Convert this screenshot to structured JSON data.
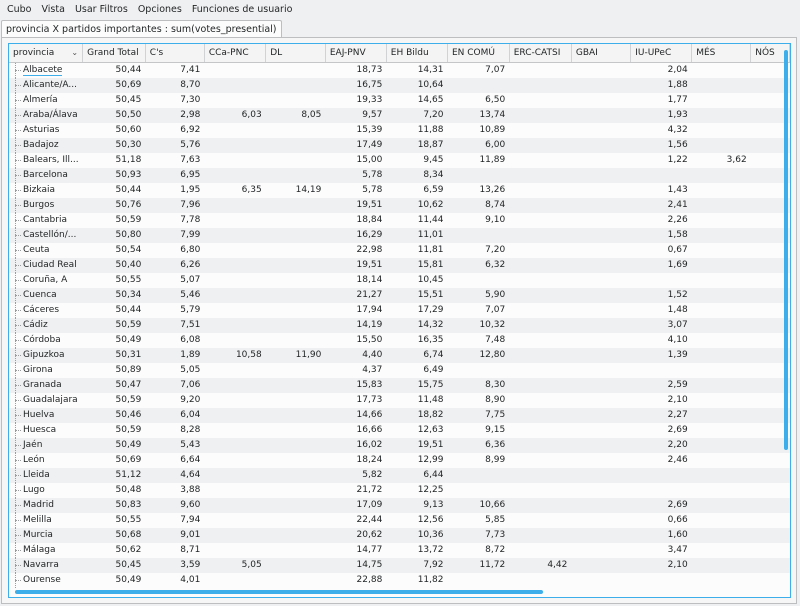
{
  "menu": [
    "Cubo",
    "Vista",
    "Usar Filtros",
    "Opciones",
    "Funciones de usuario"
  ],
  "tab": {
    "label": "provincia X partidos importantes : sum(votes_presential)"
  },
  "table": {
    "columns": [
      "provincia",
      "Grand Total",
      "C's",
      "CCa-PNC",
      "DL",
      "EAJ-PNV",
      "EH Bildu",
      "EN COMÚ",
      "ERC-CATSI",
      "GBAI",
      "IU-UPeC",
      "MÉS",
      "NÓS"
    ],
    "rows": [
      [
        "Albacete",
        "50,44",
        "7,41",
        "",
        "",
        "18,73",
        "14,31",
        "7,07",
        "",
        "",
        "2,04",
        "",
        ""
      ],
      [
        "Alicante/A...",
        "50,69",
        "8,70",
        "",
        "",
        "16,75",
        "10,64",
        "",
        "",
        "",
        "1,88",
        "",
        ""
      ],
      [
        "Almería",
        "50,45",
        "7,30",
        "",
        "",
        "19,33",
        "14,65",
        "6,50",
        "",
        "",
        "1,77",
        "",
        ""
      ],
      [
        "Araba/Álava",
        "50,50",
        "2,98",
        "6,03",
        "8,05",
        "9,57",
        "7,20",
        "13,74",
        "",
        "",
        "1,93",
        "",
        ""
      ],
      [
        "Asturias",
        "50,60",
        "6,92",
        "",
        "",
        "15,39",
        "11,88",
        "10,89",
        "",
        "",
        "4,32",
        "",
        ""
      ],
      [
        "Badajoz",
        "50,30",
        "5,76",
        "",
        "",
        "17,49",
        "18,87",
        "6,00",
        "",
        "",
        "1,56",
        "",
        ""
      ],
      [
        "Balears, Ill...",
        "51,18",
        "7,63",
        "",
        "",
        "15,00",
        "9,45",
        "11,89",
        "",
        "",
        "1,22",
        "3,62",
        ""
      ],
      [
        "Barcelona",
        "50,93",
        "6,95",
        "",
        "",
        "5,78",
        "8,34",
        "",
        "",
        "",
        "",
        "",
        ""
      ],
      [
        "Bizkaia",
        "50,44",
        "1,95",
        "6,35",
        "14,19",
        "5,78",
        "6,59",
        "13,26",
        "",
        "",
        "1,43",
        "",
        ""
      ],
      [
        "Burgos",
        "50,76",
        "7,96",
        "",
        "",
        "19,51",
        "10,62",
        "8,74",
        "",
        "",
        "2,41",
        "",
        ""
      ],
      [
        "Cantabria",
        "50,59",
        "7,78",
        "",
        "",
        "18,84",
        "11,44",
        "9,10",
        "",
        "",
        "2,26",
        "",
        ""
      ],
      [
        "Castellón/...",
        "50,80",
        "7,99",
        "",
        "",
        "16,29",
        "11,01",
        "",
        "",
        "",
        "1,58",
        "",
        ""
      ],
      [
        "Ceuta",
        "50,54",
        "6,80",
        "",
        "",
        "22,98",
        "11,81",
        "7,20",
        "",
        "",
        "0,67",
        "",
        ""
      ],
      [
        "Ciudad Real",
        "50,40",
        "6,26",
        "",
        "",
        "19,51",
        "15,81",
        "6,32",
        "",
        "",
        "1,69",
        "",
        ""
      ],
      [
        "Coruña, A",
        "50,55",
        "5,07",
        "",
        "",
        "18,14",
        "10,45",
        "",
        "",
        "",
        "",
        "",
        ""
      ],
      [
        "Cuenca",
        "50,34",
        "5,46",
        "",
        "",
        "21,27",
        "15,51",
        "5,90",
        "",
        "",
        "1,52",
        "",
        ""
      ],
      [
        "Cáceres",
        "50,44",
        "5,79",
        "",
        "",
        "17,94",
        "17,29",
        "7,07",
        "",
        "",
        "1,48",
        "",
        ""
      ],
      [
        "Cádiz",
        "50,59",
        "7,51",
        "",
        "",
        "14,19",
        "14,32",
        "10,32",
        "",
        "",
        "3,07",
        "",
        ""
      ],
      [
        "Córdoba",
        "50,49",
        "6,08",
        "",
        "",
        "15,50",
        "16,35",
        "7,48",
        "",
        "",
        "4,10",
        "",
        ""
      ],
      [
        "Gipuzkoa",
        "50,31",
        "1,89",
        "10,58",
        "11,90",
        "4,40",
        "6,74",
        "12,80",
        "",
        "",
        "1,39",
        "",
        ""
      ],
      [
        "Girona",
        "50,89",
        "5,05",
        "",
        "",
        "4,37",
        "6,49",
        "",
        "",
        "",
        "",
        "",
        ""
      ],
      [
        "Granada",
        "50,47",
        "7,06",
        "",
        "",
        "15,83",
        "15,75",
        "8,30",
        "",
        "",
        "2,59",
        "",
        ""
      ],
      [
        "Guadalajara",
        "50,59",
        "9,20",
        "",
        "",
        "17,73",
        "11,48",
        "8,90",
        "",
        "",
        "2,10",
        "",
        ""
      ],
      [
        "Huelva",
        "50,46",
        "6,04",
        "",
        "",
        "14,66",
        "18,82",
        "7,75",
        "",
        "",
        "2,27",
        "",
        ""
      ],
      [
        "Huesca",
        "50,59",
        "8,28",
        "",
        "",
        "16,66",
        "12,63",
        "9,15",
        "",
        "",
        "2,69",
        "",
        ""
      ],
      [
        "Jaén",
        "50,49",
        "5,43",
        "",
        "",
        "16,02",
        "19,51",
        "6,36",
        "",
        "",
        "2,20",
        "",
        ""
      ],
      [
        "León",
        "50,69",
        "6,64",
        "",
        "",
        "18,24",
        "12,99",
        "8,99",
        "",
        "",
        "2,46",
        "",
        ""
      ],
      [
        "Lleida",
        "51,12",
        "4,64",
        "",
        "",
        "5,82",
        "6,44",
        "",
        "",
        "",
        "",
        "",
        ""
      ],
      [
        "Lugo",
        "50,48",
        "3,88",
        "",
        "",
        "21,72",
        "12,25",
        "",
        "",
        "",
        "",
        "",
        ""
      ],
      [
        "Madrid",
        "50,83",
        "9,60",
        "",
        "",
        "17,09",
        "9,13",
        "10,66",
        "",
        "",
        "2,69",
        "",
        ""
      ],
      [
        "Melilla",
        "50,55",
        "7,94",
        "",
        "",
        "22,44",
        "12,56",
        "5,85",
        "",
        "",
        "0,66",
        "",
        ""
      ],
      [
        "Murcia",
        "50,68",
        "9,01",
        "",
        "",
        "20,62",
        "10,36",
        "7,73",
        "",
        "",
        "1,60",
        "",
        ""
      ],
      [
        "Málaga",
        "50,62",
        "8,71",
        "",
        "",
        "14,77",
        "13,72",
        "8,72",
        "",
        "",
        "3,47",
        "",
        ""
      ],
      [
        "Navarra",
        "50,45",
        "3,59",
        "5,05",
        "",
        "14,75",
        "7,92",
        "11,72",
        "4,42",
        "",
        "2,10",
        "",
        ""
      ],
      [
        "Ourense",
        "50,49",
        "4,01",
        "",
        "",
        "22,88",
        "11,82",
        "",
        "",
        "",
        "",
        "",
        ""
      ]
    ]
  }
}
